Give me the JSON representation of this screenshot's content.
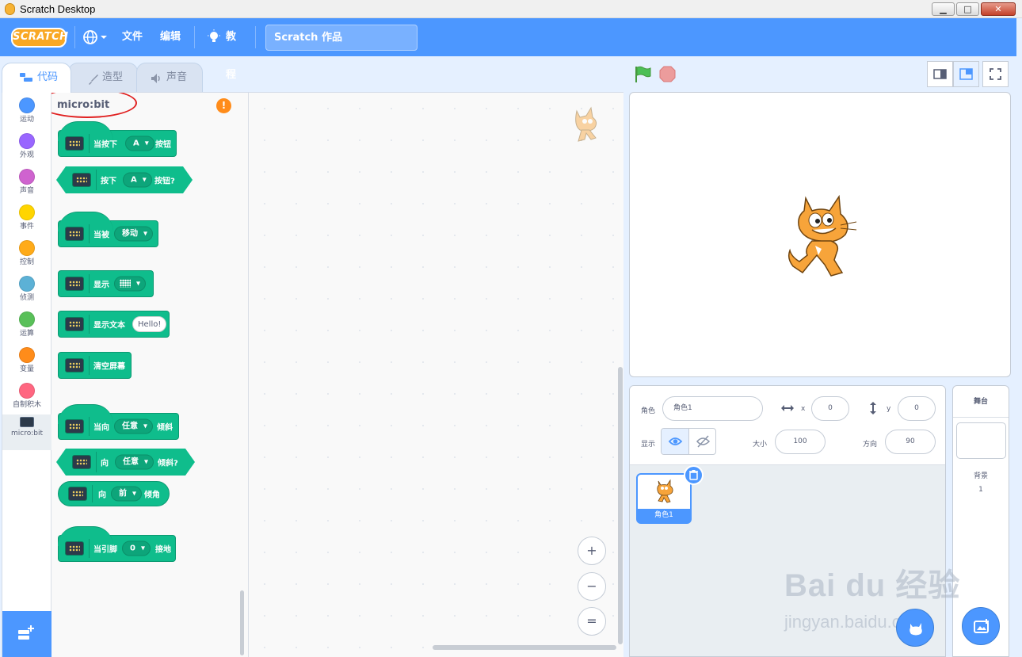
{
  "window": {
    "title": "Scratch Desktop"
  },
  "menubar": {
    "logo": "SCRATCH",
    "file": "文件",
    "edit": "编辑",
    "tutorials": "教程",
    "project_title": "Scratch 作品"
  },
  "tabs": [
    {
      "label": "代码",
      "icon": "code-icon",
      "active": true
    },
    {
      "label": "造型",
      "icon": "brush-icon",
      "active": false
    },
    {
      "label": "声音",
      "icon": "speaker-icon",
      "active": false
    }
  ],
  "categories": [
    {
      "label": "运动",
      "color": "#4c97ff"
    },
    {
      "label": "外观",
      "color": "#9966ff"
    },
    {
      "label": "声音",
      "color": "#cf63cf"
    },
    {
      "label": "事件",
      "color": "#ffd500"
    },
    {
      "label": "控制",
      "color": "#ffab19"
    },
    {
      "label": "侦测",
      "color": "#5cb1d6"
    },
    {
      "label": "运算",
      "color": "#59c059"
    },
    {
      "label": "变量",
      "color": "#ff8c1a"
    },
    {
      "label": "自制积木",
      "color": "#ff6680"
    },
    {
      "label": "micro:bit",
      "color": "#0fbd8c"
    }
  ],
  "palette": {
    "title": "micro:bit",
    "blocks": {
      "b1": {
        "pre": "当按下",
        "dd": "A",
        "post": "按钮"
      },
      "b2": {
        "pre": "按下",
        "dd": "A",
        "post": "按钮?"
      },
      "b3": {
        "pre": "当被",
        "dd": "移动"
      },
      "b4": {
        "pre": "显示"
      },
      "b5": {
        "pre": "显示文本",
        "input": "Hello!"
      },
      "b6": {
        "pre": "清空屏幕"
      },
      "b7": {
        "pre": "当向",
        "dd": "任意",
        "post": "倾斜"
      },
      "b8": {
        "pre": "向",
        "dd": "任意",
        "post": "倾斜?"
      },
      "b9": {
        "pre": "向",
        "dd": "前",
        "post": "倾角"
      },
      "b10": {
        "pre": "当引脚",
        "dd": "0",
        "post": "接地"
      }
    }
  },
  "zoom": {
    "in": "+",
    "out": "−",
    "reset": "="
  },
  "sprite_info": {
    "sprite_label": "角色",
    "sprite_name": "角色1",
    "x_label": "x",
    "x_value": "0",
    "y_label": "y",
    "y_value": "0",
    "show_label": "显示",
    "size_label": "大小",
    "size_value": "100",
    "direction_label": "方向",
    "direction_value": "90"
  },
  "sprite_list": [
    {
      "name": "角色1",
      "selected": true
    }
  ],
  "stage_pane": {
    "title": "舞台",
    "backdrops_label": "背景",
    "backdrops_count": "1"
  },
  "watermark": {
    "line1": "Bai du 经验",
    "line2": "jingyan.baidu.com"
  },
  "colors": {
    "primary": "#4c97ff",
    "microbit_green": "#0fbd8c",
    "highlight": "#e02020"
  }
}
